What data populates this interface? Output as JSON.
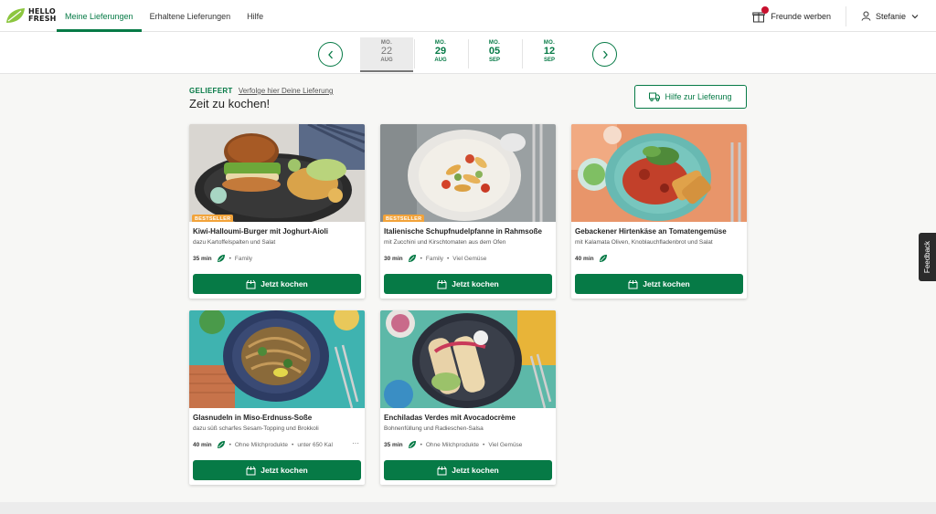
{
  "brand": {
    "line1": "HELLO",
    "line2": "FRESH"
  },
  "nav": [
    {
      "label": "Meine Lieferungen",
      "active": true
    },
    {
      "label": "Erhaltene Lieferungen",
      "active": false
    },
    {
      "label": "Hilfe",
      "active": false
    }
  ],
  "header": {
    "friends_label": "Freunde werben",
    "user_name": "Stefanie"
  },
  "weeks": [
    {
      "dow": "MO.",
      "day": "22",
      "month": "AUG",
      "selected": true
    },
    {
      "dow": "MO.",
      "day": "29",
      "month": "AUG",
      "selected": false
    },
    {
      "dow": "MO.",
      "day": "05",
      "month": "SEP",
      "selected": false
    },
    {
      "dow": "MO.",
      "day": "12",
      "month": "SEP",
      "selected": false
    }
  ],
  "delivery": {
    "status": "GELIEFERT",
    "track_link": "Verfolge hier Deine Lieferung",
    "title": "Zeit zu kochen!",
    "help_button": "Hilfe zur Lieferung"
  },
  "recipes": [
    {
      "badge": "BESTSELLER",
      "title": "Kiwi-Halloumi-Burger mit Joghurt-Aioli",
      "subtitle": "dazu Kartoffelspalten und Salat",
      "time": "35 min",
      "tags": [
        "Family"
      ],
      "button": "Jetzt kochen"
    },
    {
      "badge": "BESTSELLER",
      "title": "Italienische Schupfnudelpfanne in Rahmsoße",
      "subtitle": "mit Zucchini und Kirschtomaten aus dem Ofen",
      "time": "30 min",
      "tags": [
        "Family",
        "Viel Gemüse"
      ],
      "button": "Jetzt kochen"
    },
    {
      "badge": "",
      "title": "Gebackener Hirtenkäse an Tomatengemüse",
      "subtitle": "mit Kalamata Oliven, Knoblauchfladenbrot und Salat",
      "time": "40 min",
      "tags": [],
      "button": "Jetzt kochen"
    },
    {
      "badge": "",
      "title": "Glasnudeln in Miso-Erdnuss-Soße",
      "subtitle": "dazu süß scharfes Sesam-Topping und Brokkoli",
      "time": "40 min",
      "tags": [
        "Ohne Milchprodukte",
        "unter 650 Kal"
      ],
      "more": "···",
      "button": "Jetzt kochen"
    },
    {
      "badge": "",
      "title": "Enchiladas Verdes mit Avocadocrème",
      "subtitle": "Bohnenfüllung und Radieschen-Salsa",
      "time": "35 min",
      "tags": [
        "Ohne Milchprodukte",
        "Viel Gemüse"
      ],
      "button": "Jetzt kochen"
    }
  ],
  "feedback_label": "Feedback",
  "colors": {
    "brand_green": "#067a46",
    "badge_orange": "#f2a33a",
    "logo_green": "#8cc63f"
  },
  "icons": {
    "leaf": "leaf-icon",
    "box": "box-icon",
    "truck": "truck-icon",
    "gift": "gift-icon",
    "user": "user-icon"
  }
}
